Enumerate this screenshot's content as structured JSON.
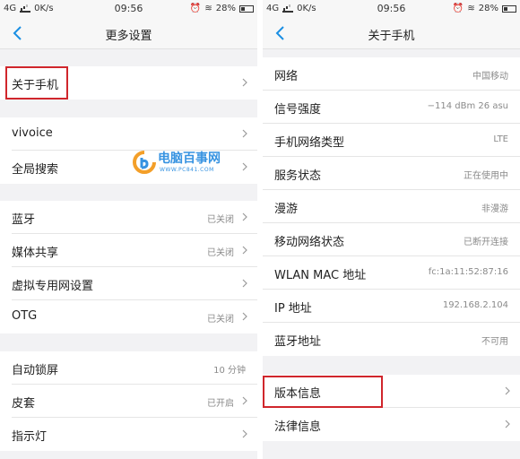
{
  "status_left": {
    "network": "4G",
    "speed": "0K/s",
    "time": "09:56",
    "battery": "28%"
  },
  "status_right": {
    "network": "4G",
    "speed": "0K/s",
    "time": "09:56",
    "battery": "28%"
  },
  "left_screen": {
    "title": "更多设置",
    "items": [
      {
        "label": "关于手机",
        "value": ""
      },
      {
        "label": "vivoice",
        "value": ""
      },
      {
        "label": "全局搜索",
        "value": ""
      },
      {
        "label": "蓝牙",
        "value": "已关闭"
      },
      {
        "label": "媒体共享",
        "value": "已关闭"
      },
      {
        "label": "虚拟专用网设置",
        "value": ""
      },
      {
        "label": "OTG",
        "value": "已关闭"
      },
      {
        "label": "自动锁屏",
        "value": "10 分钟"
      },
      {
        "label": "皮套",
        "value": "已开启"
      },
      {
        "label": "指示灯",
        "value": ""
      }
    ]
  },
  "right_screen": {
    "title": "关于手机",
    "items": [
      {
        "label": "网络",
        "value": "中国移动"
      },
      {
        "label": "信号强度",
        "value": "−114 dBm  26 asu"
      },
      {
        "label": "手机网络类型",
        "value": "LTE"
      },
      {
        "label": "服务状态",
        "value": "正在使用中"
      },
      {
        "label": "漫游",
        "value": "非漫游"
      },
      {
        "label": "移动网络状态",
        "value": "已断开连接"
      },
      {
        "label": "WLAN MAC 地址",
        "value": "fc:1a:11:52:87:16"
      },
      {
        "label": "IP 地址",
        "value": "192.168.2.104"
      },
      {
        "label": "蓝牙地址",
        "value": "不可用"
      },
      {
        "label": "版本信息",
        "value": ""
      },
      {
        "label": "法律信息",
        "value": ""
      }
    ]
  },
  "watermark": {
    "text": "电脑百事网",
    "url": "WWW.PC841.COM"
  },
  "colors": {
    "accent": "#1a8fe3",
    "highlight": "#d0262c"
  }
}
